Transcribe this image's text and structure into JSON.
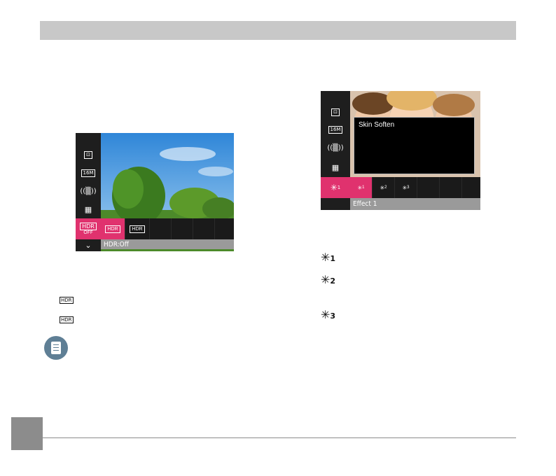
{
  "hdr_screen": {
    "status_text": "HDR:Off",
    "menu_icons": [
      "metering-icon",
      "size-16m-icon",
      "stabilizer-off-icon",
      "mode-off-icon",
      "hdr-off-icon",
      "chevron-down-icon"
    ],
    "menu_labels": [
      "16M",
      "HDR",
      "OFF"
    ],
    "options": [
      "hdr-off-option",
      "hdr-on-option"
    ]
  },
  "beauty_screen": {
    "popup_title": "Skin Soften",
    "status_text": "Effect 1",
    "menu_labels": [
      "16M"
    ],
    "effect_labels": [
      "1",
      "2",
      "3"
    ]
  },
  "hdr_legend": {
    "items": [
      "hdr-off-icon",
      "hdr-on-icon"
    ]
  },
  "effect_legend": {
    "subscripts": [
      "1",
      "2",
      "3"
    ]
  },
  "colors": {
    "accent": "#e0326e",
    "header_bar": "#c8c8c8",
    "status_bar": "#9a9a9a"
  }
}
